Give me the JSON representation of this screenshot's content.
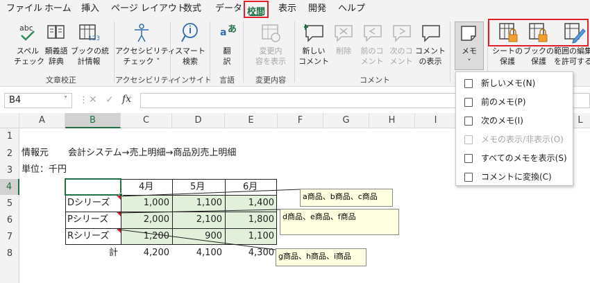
{
  "menu": {
    "file": "ファイル",
    "home": "ホーム",
    "insert": "挿入",
    "page_layout": "ページ レイアウト",
    "formulas": "数式",
    "data": "データ",
    "review": "校閲",
    "view": "表示",
    "developer": "開発",
    "help": "ヘルプ"
  },
  "ribbon": {
    "spelling_l1": "スペル",
    "spelling_l2": "チェック",
    "thesaurus_l1": "類義語",
    "thesaurus_l2": "辞典",
    "workbook_stats_l1": "ブックの統",
    "workbook_stats_l2": "計情報",
    "group_proofing": "文章校正",
    "accessibility_l1": "アクセシビリティ",
    "accessibility_l2": "チェック ˅",
    "group_accessibility": "アクセシビリティ",
    "smart_lookup_l1": "スマート",
    "smart_lookup_l2": "検索",
    "group_insights": "インサイト",
    "translate_l1": "翻",
    "translate_l2": "訳",
    "group_language": "言語",
    "show_changes_l1": "変更内",
    "show_changes_l2": "容を表示",
    "group_changes": "変更内容",
    "new_comment_l1": "新しい",
    "new_comment_l2": "コメント",
    "delete_comment": "削除",
    "prev_comment_l1": "前のコ",
    "prev_comment_l2": "メント",
    "next_comment_l1": "次のコ",
    "next_comment_l2": "メント",
    "show_comments_l1": "コメント",
    "show_comments_l2": "の表示",
    "group_comments": "コメント",
    "notes": "メモ",
    "notes_caret": "˅",
    "protect_sheet_l1": "シートの",
    "protect_sheet_l2": "保護",
    "protect_workbook_l1": "ブックの",
    "protect_workbook_l2": "保護",
    "allow_edit_l1": "範囲の編集",
    "allow_edit_l2": "を許可する",
    "translate_icon_a": "あ"
  },
  "formula_bar": {
    "name_box": "B4",
    "fx": "fx",
    "cancel": "✕",
    "enter": "✓"
  },
  "columns": [
    "A",
    "B",
    "C",
    "D",
    "E",
    "F",
    "G",
    "H",
    "I",
    "L"
  ],
  "rows": [
    "1",
    "2",
    "3",
    "4",
    "5",
    "6",
    "7",
    "8"
  ],
  "sheet": {
    "a2": "情報元",
    "b2": "会計システム→売上明細→商品別売上明細",
    "a3": "単位：千円",
    "month_headers": [
      "4月",
      "5月",
      "6月"
    ],
    "series": [
      {
        "name": "Dシリーズ",
        "values": [
          "1,000",
          "1,100",
          "1,400"
        ]
      },
      {
        "name": "Pシリーズ",
        "values": [
          "2,000",
          "2,100",
          "1,800"
        ]
      },
      {
        "name": "Rシリーズ",
        "values": [
          "1,200",
          "900",
          "1,100"
        ]
      }
    ],
    "total_label": "計",
    "totals": [
      "4,200",
      "4,100",
      "4,300"
    ]
  },
  "notes_popups": [
    "a商品、b商品、c商品",
    "d商品、e商品、f商品",
    "g商品、h商品、i商品"
  ],
  "dropdown": {
    "new_note": "新しいメモ(N)",
    "prev_note": "前のメモ(P)",
    "next_note": "次のメモ(I)",
    "show_hide_note": "メモの表示/非表示(O)",
    "show_all_notes": "すべてのメモを表示(S)",
    "convert_to_comments": "コメントに変換(C)"
  },
  "colors": {
    "excel_green": "#1e7145",
    "highlight_red": "#e0202a",
    "note_bg": "#ffffe1",
    "cell_fill": "#e2efda"
  }
}
